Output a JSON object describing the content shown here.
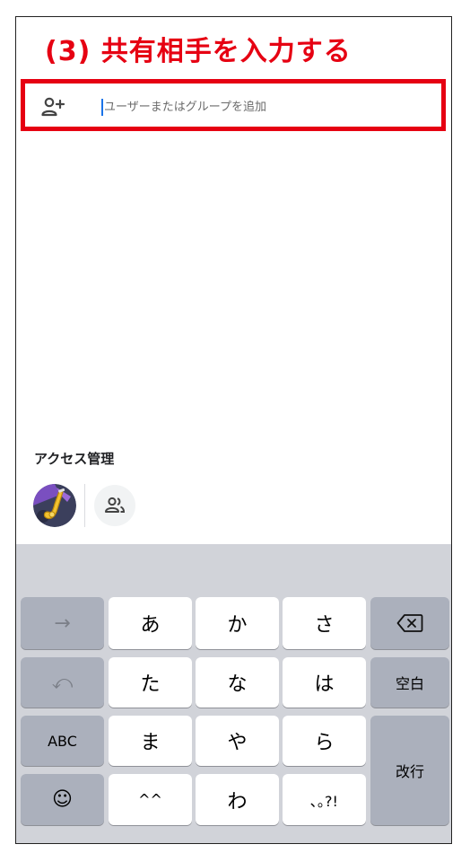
{
  "step_title": "(3) 共有相手を入力する",
  "add_people": {
    "placeholder": "ユーザーまたはグループを追加",
    "icon": "person-add-icon"
  },
  "access": {
    "section_title": "アクセス管理",
    "avatar_icon": "saxophone-avatar",
    "group_icon": "people-icon"
  },
  "keyboard": {
    "row1": [
      "→",
      "あ",
      "か",
      "さ"
    ],
    "row2": [
      "⤺",
      "た",
      "な",
      "は",
      "空白"
    ],
    "row3": [
      "ABC",
      "ま",
      "や",
      "ら"
    ],
    "row4": [
      "☺",
      "^^",
      "わ",
      "､｡?!"
    ],
    "backspace_icon": "backspace-icon",
    "return_label": "改行"
  },
  "colors": {
    "highlight": "#e60012",
    "cursor": "#1a73e8",
    "keyboard_bg": "#d1d3d9",
    "key_dark": "#abb0bc"
  }
}
